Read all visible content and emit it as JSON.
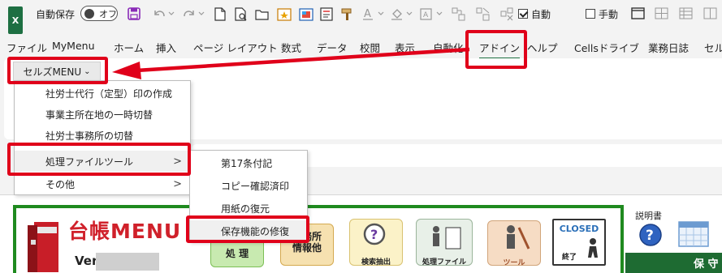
{
  "qat": {
    "excel_logo": "X",
    "autosave_label": "自動保存",
    "autosave_state": "オフ",
    "auto_label": "自動",
    "manual_label": "手動"
  },
  "tabs": [
    "ファイル",
    "MyMenu",
    "ホーム",
    "挿入",
    "ページ レイアウト",
    "数式",
    "データ",
    "校閲",
    "表示",
    "自動化",
    "アドイン",
    "ヘルプ",
    "Cellsドライブ",
    "業務日誌",
    "セル"
  ],
  "active_tab": "アドイン",
  "ribbon": {
    "menu_button": "セルズMENU",
    "menu_chevron": "⌄"
  },
  "main_menu": {
    "items": [
      {
        "label": "社労士代行（定型）印の作成"
      },
      {
        "label": "事業主所在地の一時切替"
      },
      {
        "label": "社労士事務所の切替"
      },
      {
        "label": "処理ファイルツール",
        "submenu": ">"
      },
      {
        "label": "その他",
        "submenu": ">"
      }
    ]
  },
  "sub_menu": {
    "items": [
      "第17条付記",
      "コピー確認済印",
      "用紙の復元",
      "保存機能の修復"
    ]
  },
  "sheet": {
    "title": "台帳MENU",
    "version_label": "Ver",
    "buttons": [
      {
        "label": "処 理"
      },
      {
        "label": "事務所\n情報他"
      },
      {
        "label": "検索抽出"
      },
      {
        "label": "処理ファイル"
      },
      {
        "label": "ツール"
      },
      {
        "label": "終了",
        "top_text": "CLOSED"
      }
    ],
    "manual": "説明書",
    "green_bar": "保 守"
  },
  "colors": {
    "excel_green": "#1d6f42",
    "highlight_red": "#e0001a",
    "frame_green": "#1f8a1f",
    "title_red": "#d0202a"
  }
}
